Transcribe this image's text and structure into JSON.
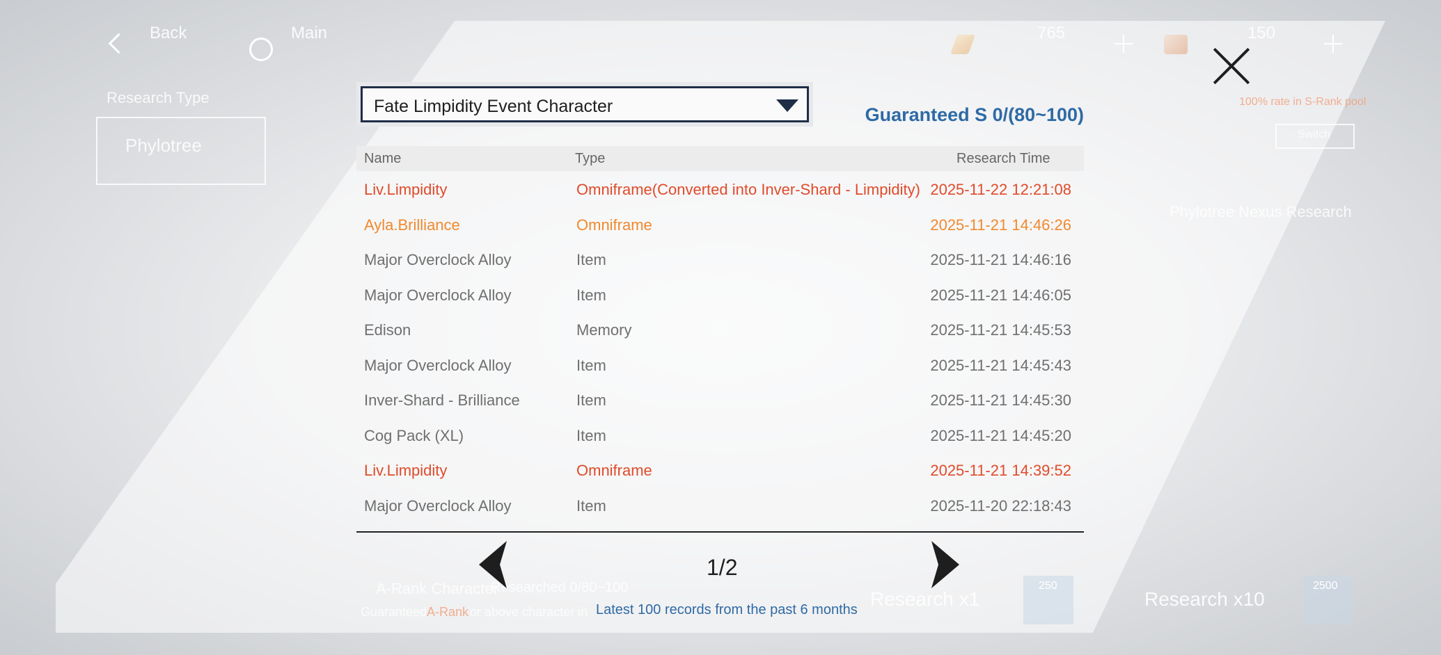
{
  "top_bar": {
    "back_label": "Back",
    "main_label": "Main",
    "currency_1": "765",
    "currency_2": "150",
    "icons": [
      "back-chevron-icon",
      "main-ring-icon",
      "pen-icon",
      "plus-icon",
      "ticket-icon",
      "plus-icon"
    ]
  },
  "background": {
    "research_type_label": "Research Type",
    "pool_name": "Phylotree",
    "rate_text": "100% rate in S-Rank pool",
    "switch_label": "Switch",
    "nexus_label": "Phylotree Nexus Research",
    "a_rank_label": "A-Rank Character",
    "researched_text": "Researched 0/80~100",
    "guaranteed_prefix": "Guaranteed",
    "a_rank_word": "A-Rank",
    "guaranteed_suffix": "or above character in",
    "research_x1": "Research x1",
    "research_x1_cost": "250",
    "research_x10": "Research x10",
    "research_x10_cost": "2500"
  },
  "dialog": {
    "pool_selected": "Fate Limpidity Event Character",
    "guaranteed_text": "Guaranteed S 0/(80~100)",
    "columns": {
      "name": "Name",
      "type": "Type",
      "time": "Research Time"
    },
    "records": [
      {
        "name": "Liv.Limpidity",
        "type": "Omniframe(Converted into Inver-Shard - Limpidity)",
        "time": "2025-11-22 12:21:08",
        "rarity": "red"
      },
      {
        "name": "Ayla.Brilliance",
        "type": "Omniframe",
        "time": "2025-11-21 14:46:26",
        "rarity": "orange"
      },
      {
        "name": "Major Overclock Alloy",
        "type": "Item",
        "time": "2025-11-21 14:46:16",
        "rarity": "normal"
      },
      {
        "name": "Major Overclock Alloy",
        "type": "Item",
        "time": "2025-11-21 14:46:05",
        "rarity": "normal"
      },
      {
        "name": "Edison",
        "type": "Memory",
        "time": "2025-11-21 14:45:53",
        "rarity": "normal"
      },
      {
        "name": "Major Overclock Alloy",
        "type": "Item",
        "time": "2025-11-21 14:45:43",
        "rarity": "normal"
      },
      {
        "name": "Inver-Shard - Brilliance",
        "type": "Item",
        "time": "2025-11-21 14:45:30",
        "rarity": "normal"
      },
      {
        "name": "Cog Pack (XL)",
        "type": "Item",
        "time": "2025-11-21 14:45:20",
        "rarity": "normal"
      },
      {
        "name": "Liv.Limpidity",
        "type": "Omniframe",
        "time": "2025-11-21 14:39:52",
        "rarity": "red"
      },
      {
        "name": "Major Overclock Alloy",
        "type": "Item",
        "time": "2025-11-20 22:18:43",
        "rarity": "normal"
      }
    ],
    "page_indicator": "1/2",
    "footnote": "Latest 100 records from the past 6 months"
  },
  "colors": {
    "s_rank": "#e04b2a",
    "a_rank": "#f0892e",
    "normal": "#6f6f6f",
    "accent_blue": "#2e6aa5",
    "dropdown_border": "#1f2d46"
  }
}
